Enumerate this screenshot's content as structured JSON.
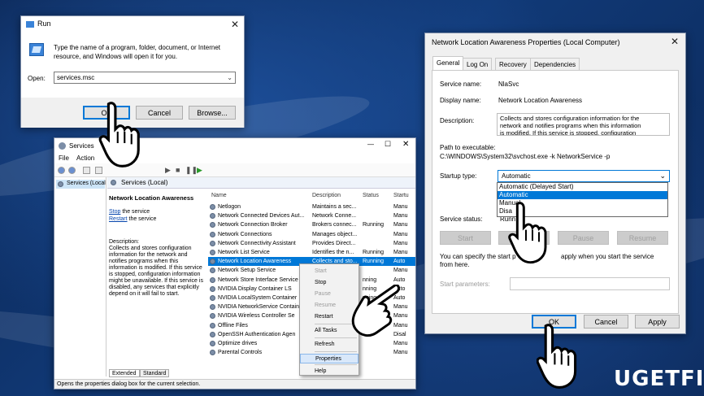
{
  "run": {
    "title": "Run",
    "close": "✕",
    "text": [
      "Type the name of a program, folder, document, or Internet",
      "resource, and Windows will open it for you."
    ],
    "open_label": "Open:",
    "open_value": "services.msc",
    "ok": "OK",
    "cancel": "Cancel",
    "browse": "Browse..."
  },
  "services": {
    "title": "Services",
    "window_controls": {
      "min": "—",
      "max": "☐",
      "close": "✕"
    },
    "menu": [
      "File",
      "Action"
    ],
    "tree_item": "Services (Local",
    "header": "Services (Local)",
    "selected_name": "Network Location Awareness",
    "stop_link": "Stop",
    "stop_rest": " the service",
    "restart_link": "Restart",
    "restart_rest": " the service",
    "description_label": "Description:",
    "description": [
      "Collects and stores configuration",
      "information for the network and",
      "notifies programs when this",
      "information is modified. If this service",
      "is stopped, configuration information",
      "might be unavailable. If this service is",
      "disabled, any services that explicitly",
      "depend on it will fail to start."
    ],
    "columns": {
      "name": "Name",
      "description": "Description",
      "status": "Status",
      "startup": "Startu"
    },
    "rows": [
      {
        "name": "Netlogon",
        "desc": "Maintains a sec...",
        "status": "",
        "startup": "Manu"
      },
      {
        "name": "Network Connected Devices Aut...",
        "desc": "Network Conne...",
        "status": "",
        "startup": "Manu"
      },
      {
        "name": "Network Connection Broker",
        "desc": "Brokers connec...",
        "status": "Running",
        "startup": "Manu"
      },
      {
        "name": "Network Connections",
        "desc": "Manages object...",
        "status": "",
        "startup": "Manu"
      },
      {
        "name": "Network Connectivity Assistant",
        "desc": "Provides Direct...",
        "status": "",
        "startup": "Manu"
      },
      {
        "name": "Network List Service",
        "desc": "Identifies the n...",
        "status": "Running",
        "startup": "Manu"
      },
      {
        "name": "Network Location Awareness",
        "desc": "Collects and sto...",
        "status": "Running",
        "startup": "Auto"
      },
      {
        "name": "Network Setup Service",
        "desc": "",
        "status": "",
        "startup": "Manu"
      },
      {
        "name": "Network Store Interface Service",
        "desc": "",
        "status": "nning",
        "startup": "Auto"
      },
      {
        "name": "NVIDIA Display Container LS",
        "desc": "",
        "status": "nning",
        "startup": "Auto"
      },
      {
        "name": "NVIDIA LocalSystem Container",
        "desc": "",
        "status": "nning",
        "startup": "Auto"
      },
      {
        "name": "NVIDIA NetworkService Contain",
        "desc": "",
        "status": "",
        "startup": "Manu"
      },
      {
        "name": "NVIDIA Wireless Controller Se",
        "desc": "",
        "status": "",
        "startup": "Manu"
      },
      {
        "name": "Offline Files",
        "desc": "",
        "status": "",
        "startup": "Manu"
      },
      {
        "name": "OpenSSH Authentication Agen",
        "desc": "",
        "status": "",
        "startup": "Disal"
      },
      {
        "name": "Optimize drives",
        "desc": "",
        "status": "",
        "startup": "Manu"
      },
      {
        "name": "Parental Controls",
        "desc": "",
        "status": "",
        "startup": "Manu"
      }
    ],
    "tabs": [
      "Extended",
      "Standard"
    ],
    "status_bar": "Opens the properties dialog box for the current selection."
  },
  "context_menu": {
    "items": [
      {
        "label": "Start",
        "disabled": true
      },
      {
        "label": "Stop",
        "disabled": false
      },
      {
        "label": "Pause",
        "disabled": true
      },
      {
        "label": "Resume",
        "disabled": true
      },
      {
        "label": "Restart",
        "disabled": false
      },
      {
        "label": "All Tasks",
        "disabled": false
      },
      {
        "label": "Refresh",
        "disabled": false
      },
      {
        "label": "Properties",
        "disabled": false
      },
      {
        "label": "Help",
        "disabled": false
      }
    ]
  },
  "properties": {
    "title": "Network Location Awareness Properties (Local Computer)",
    "close": "✕",
    "tabs": [
      "General",
      "Log On",
      "Recovery",
      "Dependencies"
    ],
    "service_name_label": "Service name:",
    "service_name": "NlaSvc",
    "display_name_label": "Display name:",
    "display_name": "Network Location Awareness",
    "description_label": "Description:",
    "description": [
      "Collects and stores configuration information for the",
      "network and notifies programs when this information",
      "is modified. If this service is stopped, configuration"
    ],
    "path_label": "Path to executable:",
    "path": "C:\\WINDOWS\\System32\\svchost.exe -k NetworkService -p",
    "startup_type_label": "Startup type:",
    "startup_type": "Automatic",
    "startup_options": [
      "Automatic (Delayed Start)",
      "Automatic",
      "Manual",
      "Disa"
    ],
    "service_status_label": "Service status:",
    "service_status": "Runn",
    "start": "Start",
    "stop": "Stop",
    "pause": "Pause",
    "resume": "Resume",
    "note_left": "You can specify the start p",
    "note_right": "apply when you start the service",
    "note_line2": "from here.",
    "start_params_label": "Start parameters:",
    "ok": "OK",
    "cancel": "Cancel",
    "apply": "Apply"
  },
  "watermark": "UG",
  "watermark2": "ETFIX"
}
